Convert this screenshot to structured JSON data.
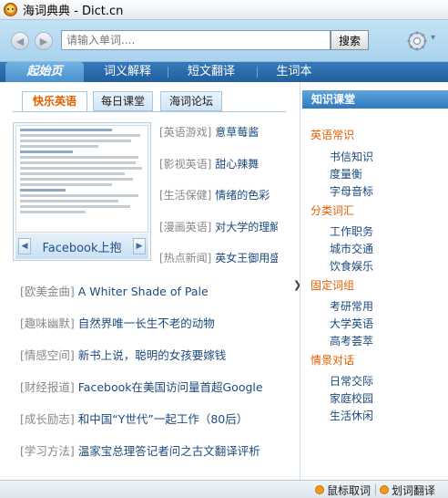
{
  "window": {
    "title": "海词典典 - Dict.cn"
  },
  "toolbar": {
    "back_glyph": "◀",
    "forward_glyph": "▶",
    "search_placeholder": "请输入单词....",
    "search_value": "",
    "search_label": "搜索",
    "settings_icon": "gear-icon"
  },
  "main_tabs": [
    {
      "label": "起始页",
      "active": true
    },
    {
      "label": "词义解释",
      "active": false
    },
    {
      "label": "短文翻译",
      "active": false
    },
    {
      "label": "生词本",
      "active": false
    }
  ],
  "sub_tabs": [
    {
      "label": "快乐英语",
      "active": true
    },
    {
      "label": "每日课堂",
      "active": false
    },
    {
      "label": "海词论坛",
      "active": false
    }
  ],
  "featured": {
    "caption": "Facebook上抱"
  },
  "right_list": [
    {
      "category": "[英语游戏]",
      "title": "意草莓酱"
    },
    {
      "category": "[影视英语]",
      "title": "甜心辣舞"
    },
    {
      "category": "[生活保健]",
      "title": "情绪的色彩"
    },
    {
      "category": "[漫画英语]",
      "title": "对大学的理解"
    },
    {
      "category": "[热点新闻]",
      "title": "英女王御用盛装"
    }
  ],
  "bottom_list": [
    {
      "category": "[欧美金曲]",
      "title": "A Whiter Shade of Pale"
    },
    {
      "category": "[趣味幽默]",
      "title": "自然界唯一长生不老的动物"
    },
    {
      "category": "[情感空间]",
      "title": "新书上说，聪明的女孩要嫁钱"
    },
    {
      "category": "[财经报道]",
      "title": "Facebook在美国访问量首超Google"
    },
    {
      "category": "[成长励志]",
      "title": "和中国“Y世代”一起工作（80后）"
    },
    {
      "category": "[学习方法]",
      "title": "温家宝总理答记者问之古文翻译评析"
    }
  ],
  "knowledge": {
    "header": "知识课堂",
    "sections": [
      {
        "title": "英语常识",
        "links": [
          "书信知识",
          "度量衡",
          "字母音标"
        ]
      },
      {
        "title": "分类词汇",
        "links": [
          "工作职务",
          "城市交通",
          "饮食娱乐"
        ]
      },
      {
        "title": "固定词组",
        "links": [
          "考研常用",
          "大学英语",
          "高考荟萃"
        ]
      },
      {
        "title": "情景对话",
        "links": [
          "日常交际",
          "家庭校园",
          "生活休闲"
        ]
      }
    ]
  },
  "statusbar": {
    "mouse_lookup": "鼠标取词",
    "select_translate": "划词翻译"
  },
  "colors": {
    "accent_orange": "#e35e00",
    "link_blue": "#1c4a7e",
    "nav_blue": "#225f9e",
    "toolbar_blue": "#a9d3ee"
  }
}
